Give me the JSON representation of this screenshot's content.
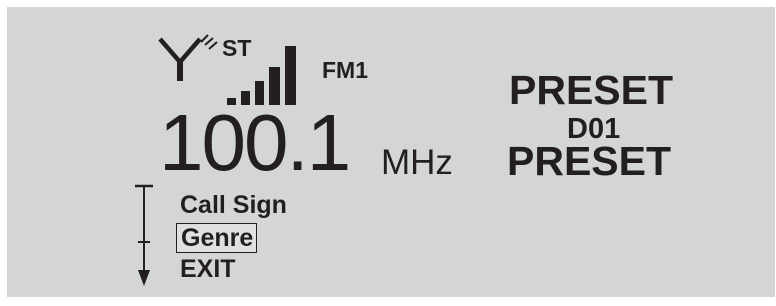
{
  "status": {
    "stereo": "ST",
    "band": "FM1",
    "antenna_icon": "antenna-icon",
    "signal_icon": "signal-strength-icon",
    "signal_bars_active": 5,
    "signal_bars_total": 5
  },
  "tuner": {
    "frequency": "100.1",
    "unit": "MHz"
  },
  "preset": {
    "line1": "PRESET",
    "number": "D01",
    "line2": "PRESET"
  },
  "menu": {
    "items": [
      {
        "label": "Call Sign",
        "selected": false
      },
      {
        "label": "Genre",
        "selected": true
      },
      {
        "label": "EXIT",
        "selected": false
      }
    ],
    "scroll_icon": "scroll-arrow-icon"
  },
  "colors": {
    "lcd_background": "#d4d5d6",
    "lcd_ink": "#231f20"
  }
}
